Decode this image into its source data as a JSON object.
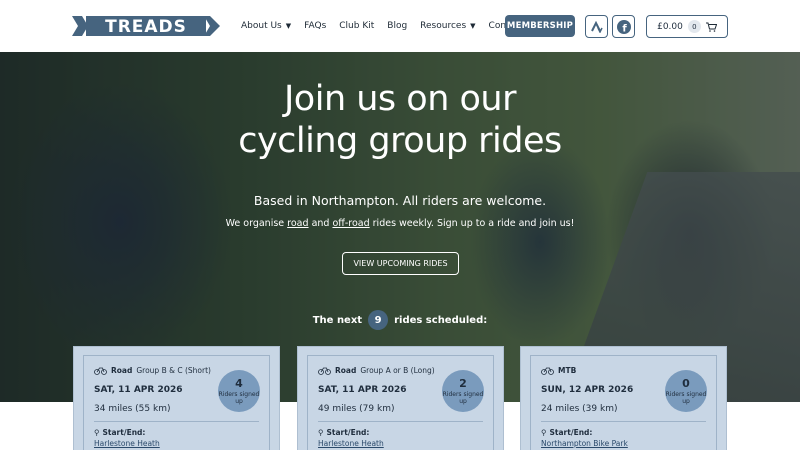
{
  "brand": {
    "logo_text": "TREADS"
  },
  "nav": {
    "items": [
      {
        "label": "About Us",
        "dropdown": true
      },
      {
        "label": "FAQs",
        "dropdown": false
      },
      {
        "label": "Club Kit",
        "dropdown": false
      },
      {
        "label": "Blog",
        "dropdown": false
      },
      {
        "label": "Resources",
        "dropdown": true
      },
      {
        "label": "Contact Us",
        "dropdown": false
      }
    ],
    "membership_label": "MEMBERSHIP",
    "strava_icon": "strava-icon",
    "facebook_icon": "facebook-icon",
    "cart": {
      "total": "£0.00",
      "count": "0"
    }
  },
  "hero": {
    "title_line1": "Join us on our",
    "title_line2": "cycling group rides",
    "tagline": "Based in Northampton. All riders are welcome.",
    "sub_prefix": "We organise ",
    "sub_road": "road",
    "sub_and": " and ",
    "sub_offroad": "off-road",
    "sub_suffix": " rides weekly. Sign up to a ride and join us!",
    "button_label": "VIEW UPCOMING RIDES",
    "next_prefix": "The next",
    "next_count": "9",
    "next_suffix": "rides scheduled:"
  },
  "colors": {
    "accent": "#46647f",
    "card_bg": "#c8d6e5",
    "badge_bg": "#7a9bbd"
  },
  "rides": [
    {
      "type_bold": "Road",
      "type_rest": "Group B & C (Short)",
      "date": "SAT, 11 APR 2026",
      "distance": "34 miles (55 km)",
      "signed": "4",
      "signed_label": "Riders signed up",
      "start_end_label": "Start/End:",
      "location": "Harlestone Heath"
    },
    {
      "type_bold": "Road",
      "type_rest": "Group A or B (Long)",
      "date": "SAT, 11 APR 2026",
      "distance": "49 miles (79 km)",
      "signed": "2",
      "signed_label": "Riders signed up",
      "start_end_label": "Start/End:",
      "location": "Harlestone Heath"
    },
    {
      "type_bold": "MTB",
      "type_rest": "",
      "date": "SUN, 12 APR 2026",
      "distance": "24 miles (39 km)",
      "signed": "0",
      "signed_label": "Riders signed up",
      "start_end_label": "Start/End:",
      "location": "Northampton Bike Park"
    }
  ]
}
